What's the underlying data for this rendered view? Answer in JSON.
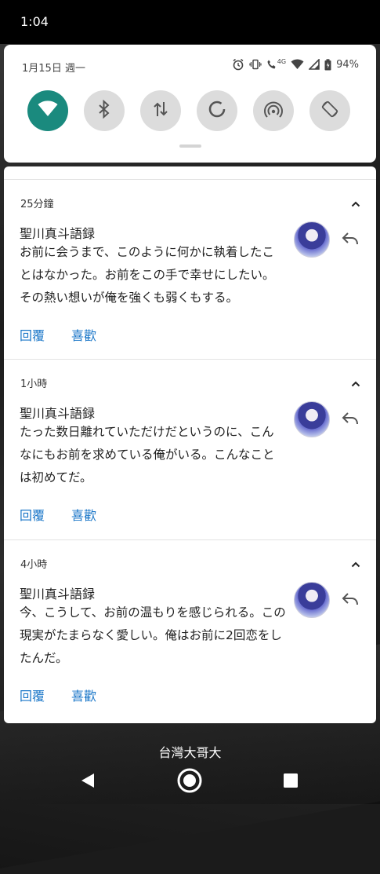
{
  "status_bar": {
    "time": "1:04"
  },
  "quick_settings": {
    "date": "1月15日 週一",
    "battery": "94%",
    "network_badge": "4G",
    "tiles": [
      {
        "name": "wifi",
        "active": true
      },
      {
        "name": "bluetooth",
        "active": false
      },
      {
        "name": "mobile-data",
        "active": false
      },
      {
        "name": "battery-saver",
        "active": false
      },
      {
        "name": "hotspot",
        "active": false
      },
      {
        "name": "auto-rotate",
        "active": false
      }
    ]
  },
  "notifications": [
    {
      "time": "25分鐘",
      "sender": "聖川真斗語録",
      "body": "お前に会うまで、このように何かに執着したことはなかった。お前をこの手で幸せにしたい。その熱い想いが俺を強くも弱くもする。",
      "reply_label": "回覆",
      "like_label": "喜歡"
    },
    {
      "time": "1小時",
      "sender": "聖川真斗語録",
      "body": "たった数日離れていただけだというのに、こんなにもお前を求めている俺がいる。こんなことは初めてだ。",
      "reply_label": "回覆",
      "like_label": "喜歡"
    },
    {
      "time": "4小時",
      "sender": "聖川真斗語録",
      "body": "今、こうして、お前の温もりを感じられる。この現実がたまらなく愛しい。俺はお前に2回恋をしたんだ。",
      "reply_label": "回覆",
      "like_label": "喜歡"
    }
  ],
  "carrier": "台灣大哥大",
  "colors": {
    "accent": "#1a8a7e",
    "link": "#1976c8"
  }
}
